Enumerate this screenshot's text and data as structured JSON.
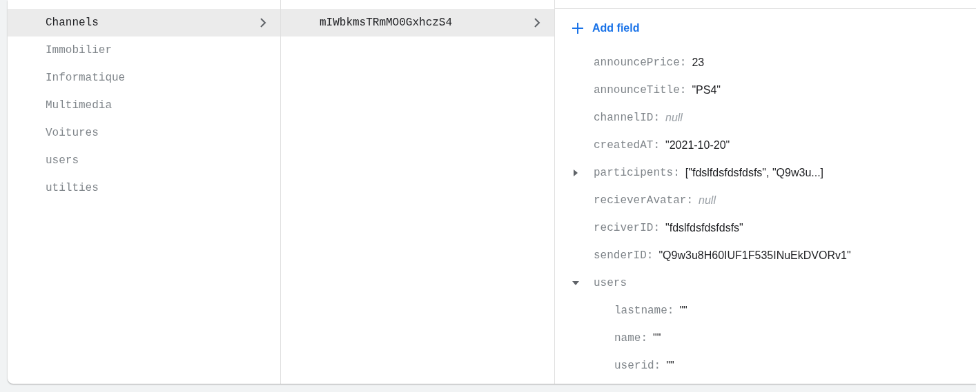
{
  "collections": [
    {
      "label": "Channels",
      "selected": true
    },
    {
      "label": "Immobilier",
      "selected": false
    },
    {
      "label": "Informatique",
      "selected": false
    },
    {
      "label": "Multimedia",
      "selected": false
    },
    {
      "label": "Voitures",
      "selected": false
    },
    {
      "label": "users",
      "selected": false
    },
    {
      "label": "utilties",
      "selected": false
    }
  ],
  "documents": [
    {
      "label": "mIWbkmsTRmMO0GxhczS4",
      "selected": true
    }
  ],
  "add_field": "Add field",
  "fields": [
    {
      "key": "announcePrice:",
      "kind": "number",
      "value": "23"
    },
    {
      "key": "announceTitle:",
      "kind": "string",
      "value": "\"PS4\""
    },
    {
      "key": "channelID:",
      "kind": "null",
      "value": "null"
    },
    {
      "key": "createdAT:",
      "kind": "string",
      "value": "\"2021-10-20\""
    },
    {
      "key": "participents:",
      "kind": "array",
      "value": "[\"fdslfdsfdsfdsfs\", \"Q9w3u...]",
      "expanded": false
    },
    {
      "key": "recieverAvatar:",
      "kind": "null",
      "value": "null"
    },
    {
      "key": "reciverID:",
      "kind": "string",
      "value": "\"fdslfdsfdsfdsfs\""
    },
    {
      "key": "senderID:",
      "kind": "string",
      "value": "\"Q9w3u8H60IUF1F535INuEkDVORv1\""
    },
    {
      "key": "users",
      "kind": "map",
      "expanded": true,
      "children": [
        {
          "key": "lastname:",
          "kind": "string",
          "value": "\"\""
        },
        {
          "key": "name:",
          "kind": "string",
          "value": "\"\""
        },
        {
          "key": "userid:",
          "kind": "string",
          "value": "\"\""
        }
      ]
    }
  ]
}
